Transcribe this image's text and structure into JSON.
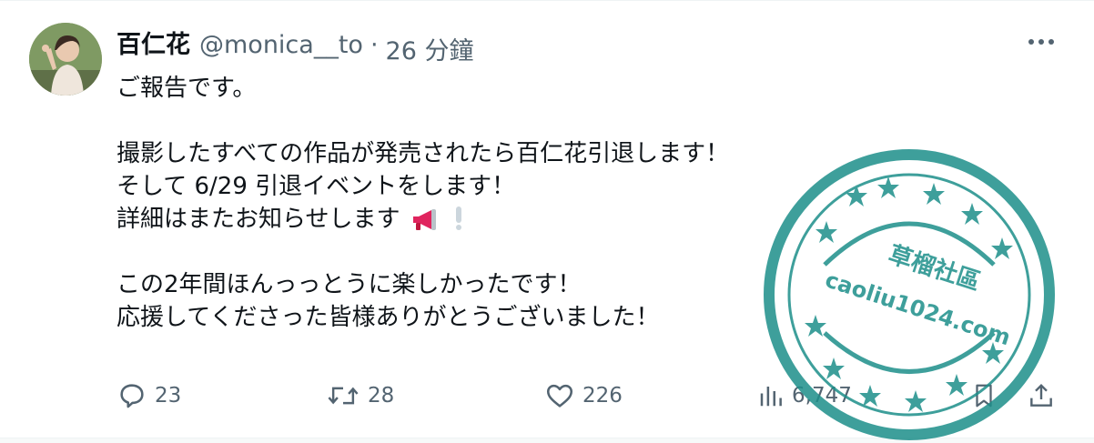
{
  "tweet": {
    "author_name": "百仁花",
    "handle": "@monica__to",
    "separator": "·",
    "time": "26 分鐘",
    "lines": [
      "ご報告です。",
      "",
      "撮影したすべての作品が発売されたら百仁花引退します！",
      "そして 6/29  引退イベントをします！",
      "詳細はまたお知らせします",
      "",
      "この2年間ほんっっとうに楽しかったです！",
      "応援してくださった皆様ありがとうございました！"
    ],
    "inline_emojis": [
      "megaphone-icon",
      "exclamation-icon"
    ]
  },
  "actions": {
    "reply_count": "23",
    "retweet_count": "28",
    "like_count": "226",
    "views_count": "6,747"
  },
  "stamp": {
    "line1": "草榴社區",
    "line2": "caoliu1024.com",
    "color": "#1d8f8a"
  },
  "colors": {
    "text": "#0f1419",
    "muted": "#536471",
    "megaphone": "#e0245e"
  }
}
